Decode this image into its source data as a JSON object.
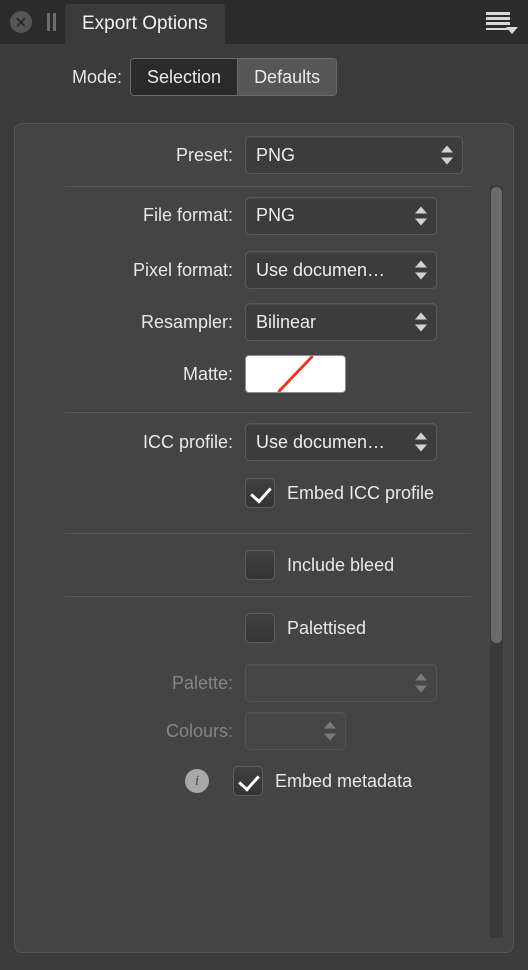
{
  "titlebar": {
    "close_icon": "close-icon",
    "pause_icon": "pause-icon",
    "tab_label": "Export Options",
    "menu_icon": "hamburger-menu-icon"
  },
  "mode": {
    "label": "Mode:",
    "options": [
      "Selection",
      "Defaults"
    ],
    "selected": "Selection"
  },
  "panel": {
    "preset": {
      "label": "Preset:",
      "value": "PNG"
    },
    "file_format": {
      "label": "File format:",
      "value": "PNG"
    },
    "pixel_format": {
      "label": "Pixel format:",
      "value": "Use documen…"
    },
    "resampler": {
      "label": "Resampler:",
      "value": "Bilinear"
    },
    "matte": {
      "label": "Matte:",
      "value": "none",
      "swatch_color": "#ffffff",
      "slash_color": "#e03a22"
    },
    "icc_profile": {
      "label": "ICC profile:",
      "value": "Use documen…"
    },
    "embed_icc": {
      "label": "Embed ICC profile",
      "checked": true
    },
    "include_bleed": {
      "label": "Include bleed",
      "checked": false
    },
    "palettised": {
      "label": "Palettised",
      "checked": false
    },
    "palette": {
      "label": "Palette:",
      "value": "",
      "enabled": false
    },
    "colours": {
      "label": "Colours:",
      "value": "",
      "enabled": false
    },
    "embed_metadata": {
      "label": "Embed metadata",
      "checked": true,
      "info_icon": "info-icon"
    }
  },
  "scrollbar": {
    "name": "vertical-scrollbar"
  },
  "colors": {
    "window_bg": "#3b3b3b",
    "titlebar_bg": "#2b2b2b",
    "panel_bg": "#444444",
    "text": "#e8e8e8",
    "text_disabled": "#858585"
  }
}
